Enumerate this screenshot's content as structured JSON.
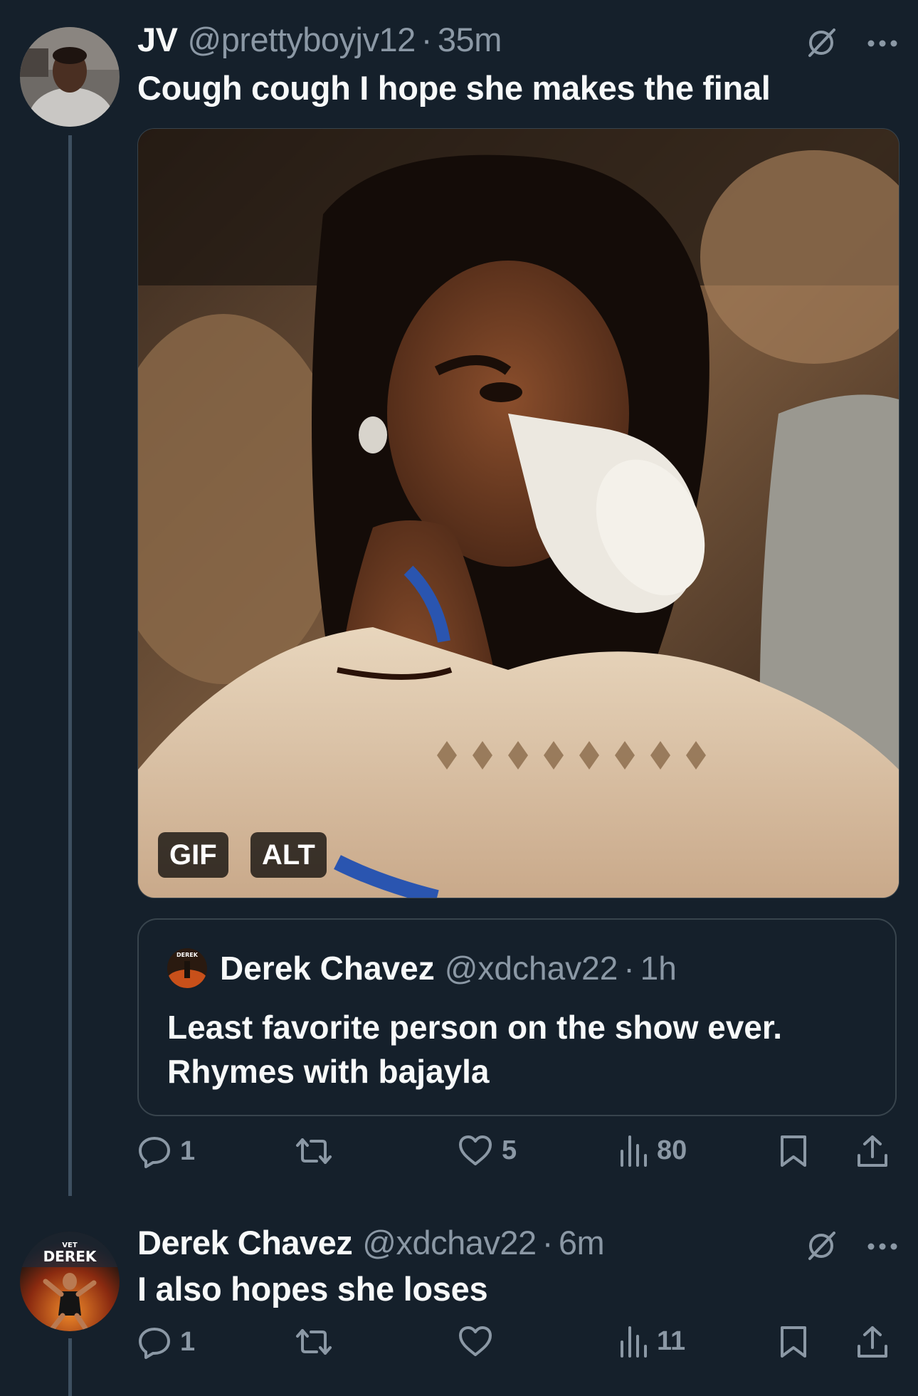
{
  "tweet1": {
    "name": "JV",
    "handle": "@prettyboyjv12",
    "separator": "·",
    "time": "35m",
    "text": "Cough cough I hope she makes the final",
    "media_badges": {
      "gif": "GIF",
      "alt": "ALT"
    },
    "quote": {
      "name": "Derek Chavez",
      "handle": "@xdchav22",
      "separator": "·",
      "time": "1h",
      "text_line1": "Least favorite person on the show ever.",
      "text_line2": "Rhymes with bajayla",
      "avatar_text": "DEREK"
    },
    "actions": {
      "replies": "1",
      "reposts": "",
      "likes": "5",
      "views": "80"
    }
  },
  "tweet2": {
    "name": "Derek Chavez",
    "handle": "@xdchav22",
    "separator": "·",
    "time": "6m",
    "text": "I also hopes she loses",
    "avatar_text": "DEREK",
    "avatar_subtext": "VET",
    "actions": {
      "replies": "1",
      "reposts": "",
      "likes": "",
      "views": "11"
    }
  },
  "colors": {
    "background": "#15202b",
    "text_primary": "#f7f9f9",
    "text_secondary": "#8b98a5",
    "border": "#38444d",
    "thread_line": "#3d4f60"
  },
  "icons": [
    "grok-icon",
    "more-icon",
    "reply-icon",
    "repost-icon",
    "like-icon",
    "views-icon",
    "bookmark-icon",
    "share-icon"
  ]
}
